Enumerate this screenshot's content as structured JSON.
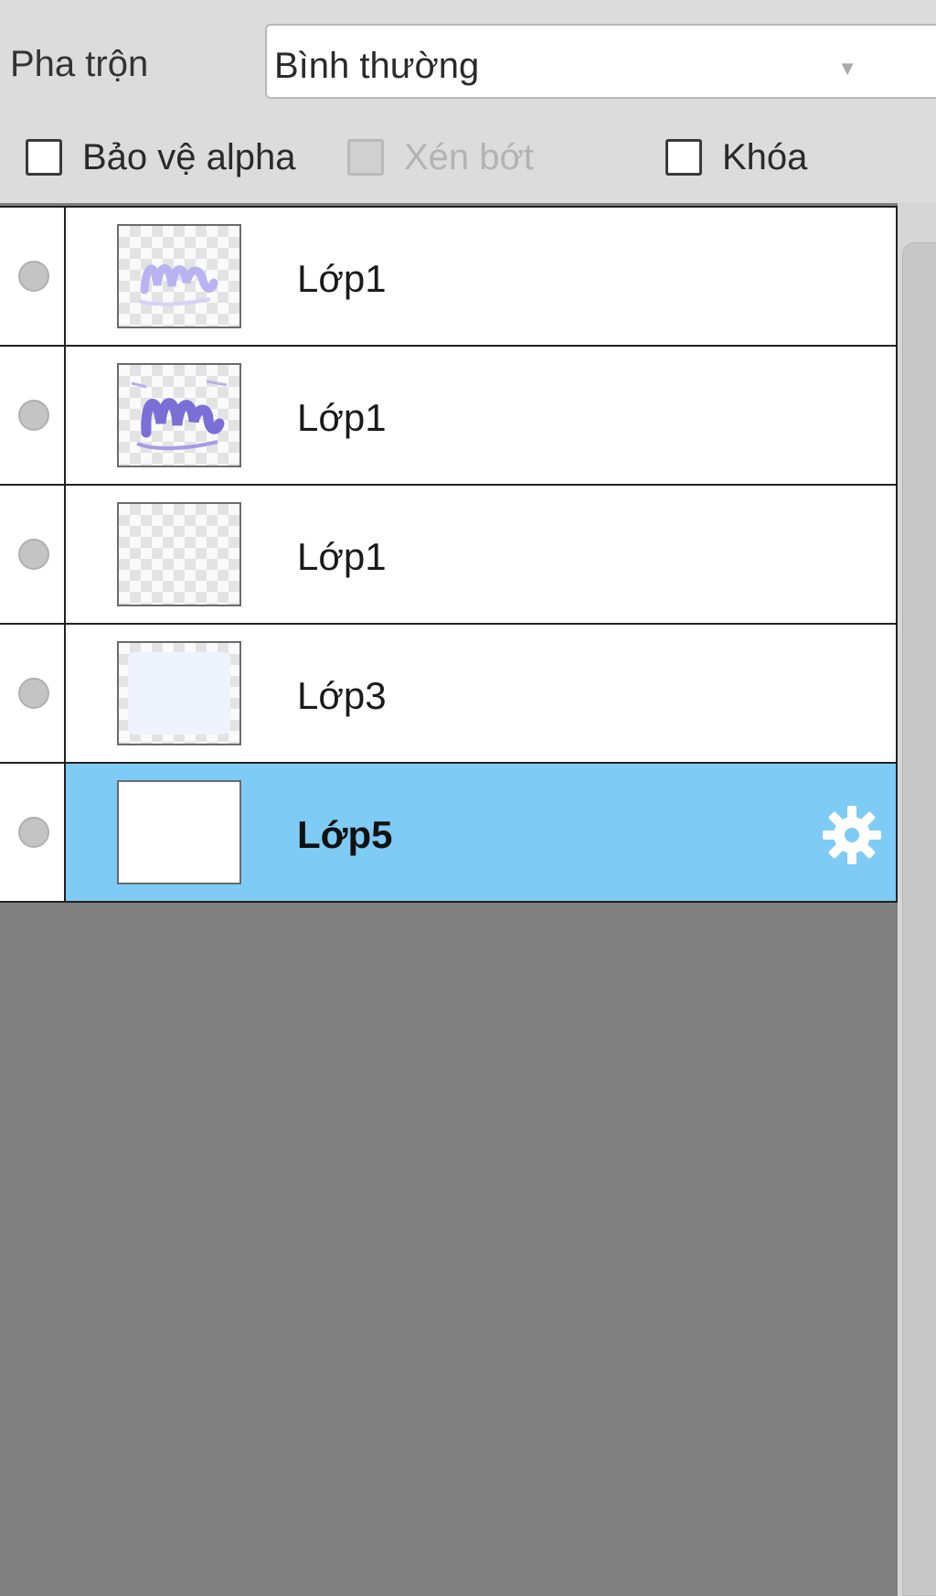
{
  "blend": {
    "label": "Pha trộn",
    "value": "Bình thường"
  },
  "options": {
    "protect_alpha": {
      "label": "Bảo vệ alpha",
      "checked": false,
      "enabled": true
    },
    "clipping": {
      "label": "Xén bớt",
      "checked": false,
      "enabled": false
    },
    "lock": {
      "label": "Khóa",
      "checked": false,
      "enabled": true
    }
  },
  "layers": [
    {
      "name": "Lớp1",
      "selected": false,
      "thumb": "scribble-light"
    },
    {
      "name": "Lớp1",
      "selected": false,
      "thumb": "scribble-dark"
    },
    {
      "name": "Lớp1",
      "selected": false,
      "thumb": "transparent"
    },
    {
      "name": "Lớp3",
      "selected": false,
      "thumb": "light-blue-fill"
    },
    {
      "name": "Lớp5",
      "selected": true,
      "thumb": "white"
    }
  ],
  "colors": {
    "selected_row": "#7ecbf5",
    "panel_bg": "#808080",
    "toolbar_bg": "#dcdcdc"
  },
  "icons": {
    "visibility": "visibility-dot-icon",
    "settings": "gear-icon",
    "dropdown": "chevron-down-icon"
  }
}
